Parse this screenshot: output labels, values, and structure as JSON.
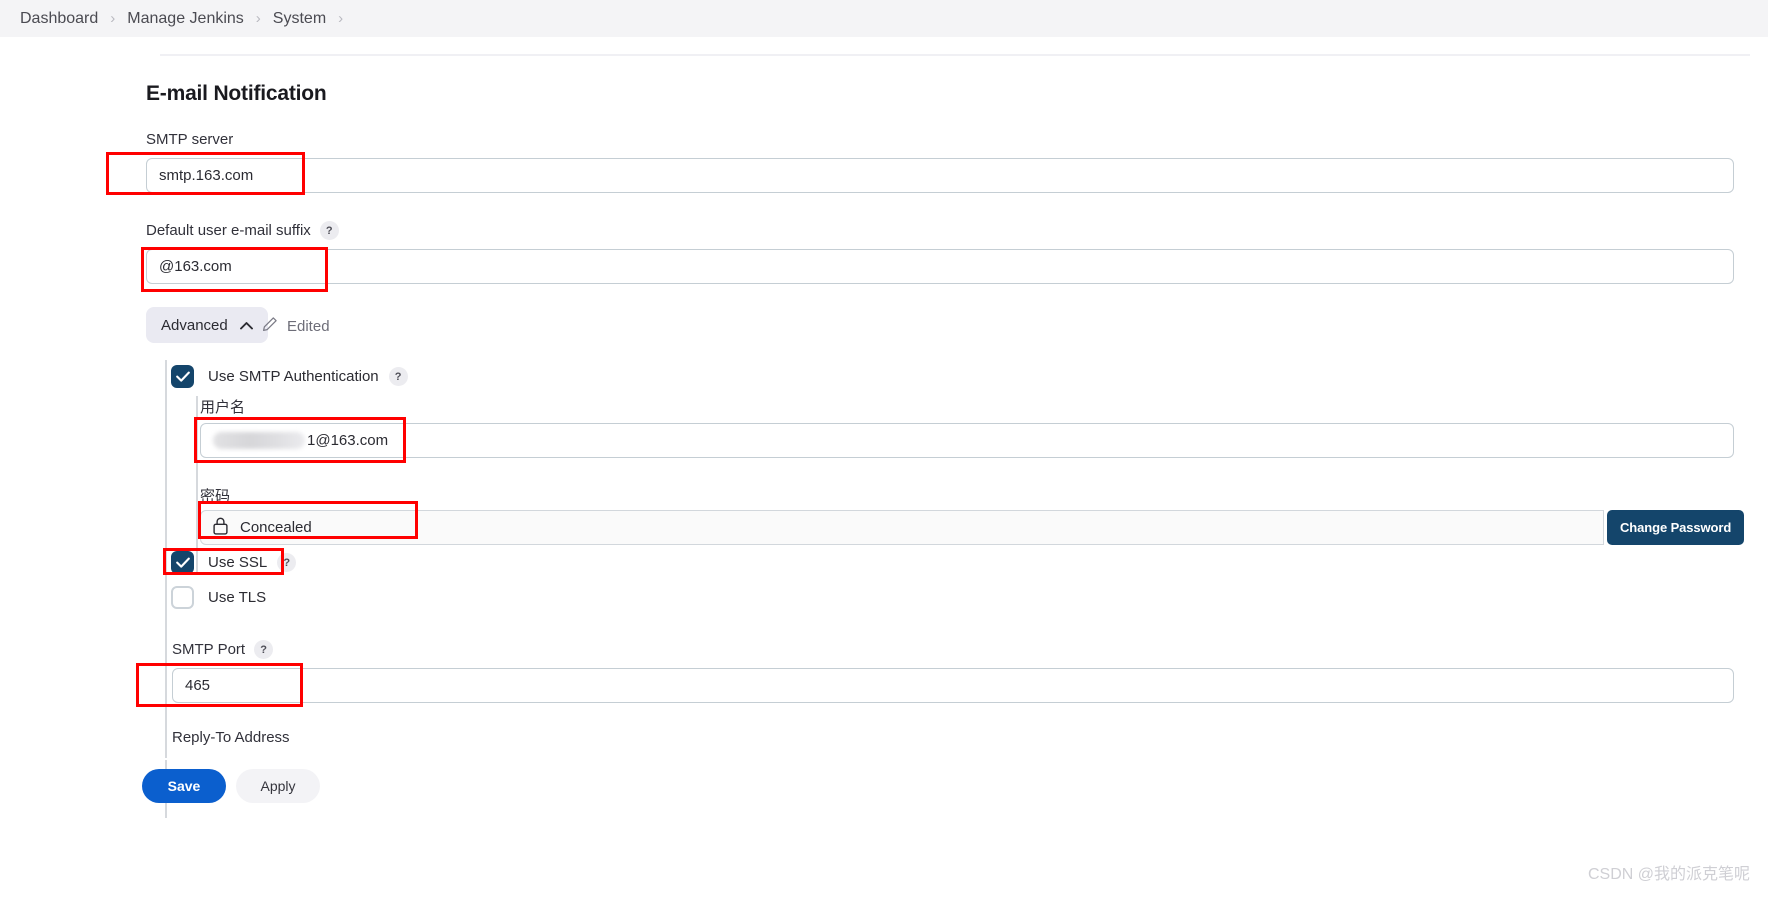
{
  "breadcrumb": {
    "items": [
      {
        "label": "Dashboard"
      },
      {
        "label": "Manage Jenkins"
      },
      {
        "label": "System"
      }
    ],
    "separator": "›"
  },
  "page": {
    "title": "E-mail Notification"
  },
  "form": {
    "smtp_server": {
      "label": "SMTP server",
      "value": "smtp.163.com"
    },
    "default_suffix": {
      "label": "Default user e-mail suffix",
      "help": "?",
      "value": "@163.com"
    },
    "advanced": {
      "label": "Advanced",
      "chevron": "chevron-up-icon",
      "edited_label": "Edited",
      "edited_icon": "pencil-icon"
    },
    "use_smtp_auth": {
      "label": "Use SMTP Authentication",
      "help": "?",
      "checked": true
    },
    "username": {
      "label": "用户名",
      "value": "1@163.com",
      "redacted": true
    },
    "password": {
      "label": "密码",
      "value": "Concealed",
      "icon": "lock-icon",
      "change_button": "Change Password"
    },
    "use_ssl": {
      "label": "Use SSL",
      "help": "?",
      "checked": true
    },
    "use_tls": {
      "label": "Use TLS",
      "checked": false
    },
    "smtp_port": {
      "label": "SMTP Port",
      "help": "?",
      "value": "465"
    },
    "reply_to": {
      "label": "Reply-To Address"
    }
  },
  "actions": {
    "save": "Save",
    "apply": "Apply"
  },
  "watermark": {
    "text": "CSDN @我的派克笔呢"
  },
  "colors": {
    "annotation": "#ff0000",
    "primary": "#0b5fce",
    "checkbox": "#14456b",
    "breadcrumb_bg": "#f4f4f6"
  }
}
